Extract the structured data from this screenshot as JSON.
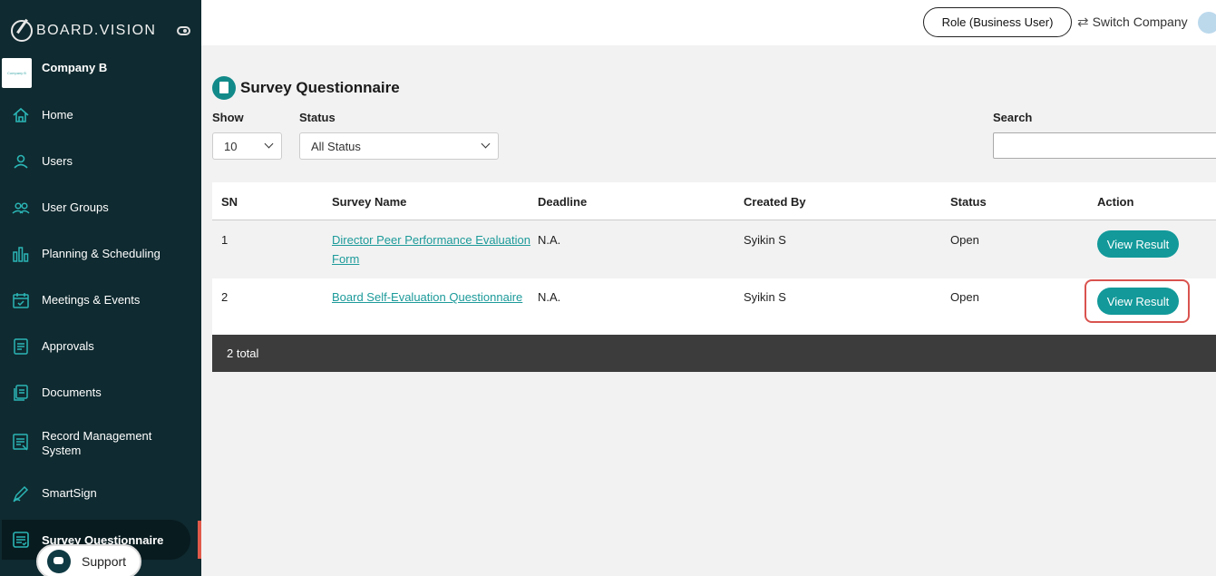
{
  "app": {
    "brand": "BOARD.VISION",
    "company_name": "Company B",
    "company_logo_text": "Company B"
  },
  "sidebar": {
    "items": [
      {
        "label": "Home",
        "icon": "home-icon"
      },
      {
        "label": "Users",
        "icon": "user-icon"
      },
      {
        "label": "User Groups",
        "icon": "user-groups-icon"
      },
      {
        "label": "Planning & Scheduling",
        "icon": "bar-chart-icon"
      },
      {
        "label": "Meetings & Events",
        "icon": "calendar-icon"
      },
      {
        "label": "Approvals",
        "icon": "approval-doc-icon"
      },
      {
        "label": "Documents",
        "icon": "documents-icon"
      },
      {
        "label": "Record Management System",
        "icon": "record-icon"
      },
      {
        "label": "SmartSign",
        "icon": "pen-icon"
      },
      {
        "label": "Survey Questionnaire",
        "icon": "survey-icon",
        "active": true
      }
    ],
    "support_label": "Support"
  },
  "topbar": {
    "role_label": "Role (Business User)",
    "switch_label": "Switch Company"
  },
  "page": {
    "title": "Survey Questionnaire",
    "show_label": "Show",
    "show_value": "10",
    "status_label": "Status",
    "status_value": "All Status",
    "search_label": "Search",
    "search_value": ""
  },
  "table": {
    "headers": {
      "sn": "SN",
      "name": "Survey Name",
      "deadline": "Deadline",
      "created_by": "Created By",
      "status": "Status",
      "action": "Action"
    },
    "rows": [
      {
        "sn": "1",
        "name_line1": "Director Peer Performance Evaluation",
        "name_line2": "Form",
        "deadline": "N.A.",
        "created_by": "Syikin S",
        "status": "Open",
        "action": "View Result"
      },
      {
        "sn": "2",
        "name_line1": "Board Self-Evaluation Questionnaire",
        "name_line2": "",
        "deadline": "N.A.",
        "created_by": "Syikin S",
        "status": "Open",
        "action": "View Result"
      }
    ],
    "total_text": "2 total"
  },
  "colors": {
    "sidebar_bg": "#0f2a30",
    "accent": "#13999a",
    "highlight": "#d9534f",
    "footer_bg": "#3c3c3c"
  }
}
